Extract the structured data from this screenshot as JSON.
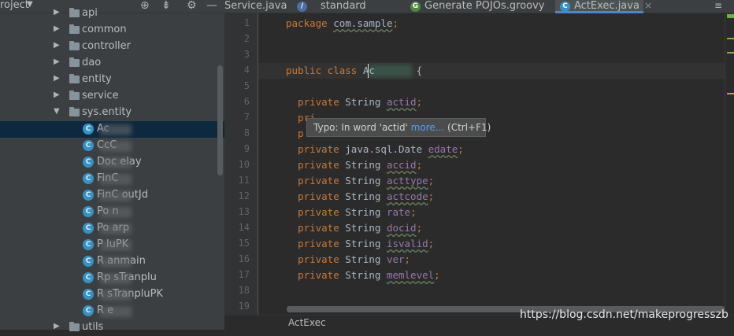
{
  "project_panel": {
    "title": "roject",
    "tree": [
      {
        "label": "api",
        "type": "folder",
        "indent": 1,
        "expanded": false
      },
      {
        "label": "common",
        "type": "folder",
        "indent": 1,
        "expanded": false
      },
      {
        "label": "controller",
        "type": "folder",
        "indent": 1,
        "expanded": false
      },
      {
        "label": "dao",
        "type": "folder",
        "indent": 1,
        "expanded": false
      },
      {
        "label": "entity",
        "type": "folder",
        "indent": 1,
        "expanded": false
      },
      {
        "label": "service",
        "type": "folder",
        "indent": 1,
        "expanded": false
      },
      {
        "label": "sys.entity",
        "type": "folder",
        "indent": 1,
        "expanded": true
      },
      {
        "label": "Ac",
        "type": "class",
        "indent": 2,
        "selected": true
      },
      {
        "label": "CcC",
        "type": "class",
        "indent": 2
      },
      {
        "label": "Doc    elay",
        "type": "class",
        "indent": 2
      },
      {
        "label": "FinC",
        "type": "class",
        "indent": 2
      },
      {
        "label": "FinC    outJd",
        "type": "class",
        "indent": 2
      },
      {
        "label": "Po          n",
        "type": "class",
        "indent": 2
      },
      {
        "label": "Po      arp",
        "type": "class",
        "indent": 2
      },
      {
        "label": "P         luPK",
        "type": "class",
        "indent": 2
      },
      {
        "label": "R        anmain",
        "type": "class",
        "indent": 2
      },
      {
        "label": "Rp     sTranplu",
        "type": "class",
        "indent": 2
      },
      {
        "label": "R      sTranpluPK",
        "type": "class",
        "indent": 2
      },
      {
        "label": "R      e",
        "type": "class",
        "indent": 2
      },
      {
        "label": "utils",
        "type": "folder",
        "indent": 1,
        "expanded": false
      }
    ]
  },
  "tabs": [
    {
      "label": "Service.java",
      "icon": "",
      "active": false
    },
    {
      "label": "standard",
      "icon": "file-icon",
      "active": false
    },
    {
      "label": "Generate POJOs.groovy",
      "icon": "groovy-icon",
      "active": false
    },
    {
      "label": "ActExec.java",
      "icon": "class-icon",
      "active": true
    }
  ],
  "editor": {
    "line_numbers": [
      "1",
      "2",
      "3",
      "4",
      "5",
      "6",
      "7",
      "8",
      "9",
      "10",
      "11",
      "12",
      "13",
      "14",
      "15",
      "16",
      "17",
      "18",
      "19"
    ],
    "lines": [
      [
        {
          "t": "package ",
          "c": "kw"
        },
        {
          "t": "com.sample",
          "c": "pkg"
        },
        {
          "t": ";",
          "c": "kw"
        }
      ],
      [],
      [],
      [
        {
          "t": "public class ",
          "c": "kw"
        },
        {
          "t": "Ac       ",
          "c": "plain"
        },
        {
          "t": "{",
          "c": "plain"
        }
      ],
      [],
      [
        {
          "t": "  private ",
          "c": "kw"
        },
        {
          "t": "String ",
          "c": "plain"
        },
        {
          "t": "actid",
          "c": "fld"
        },
        {
          "t": ";",
          "c": "kw"
        }
      ],
      [
        {
          "t": "  pri",
          "c": "kw"
        }
      ],
      [
        {
          "t": "  p",
          "c": "kw"
        }
      ],
      [
        {
          "t": "  private ",
          "c": "kw"
        },
        {
          "t": "java.sql.Date ",
          "c": "plain"
        },
        {
          "t": "edate",
          "c": "fld"
        },
        {
          "t": ";",
          "c": "kw"
        }
      ],
      [
        {
          "t": "  private ",
          "c": "kw"
        },
        {
          "t": "String ",
          "c": "plain"
        },
        {
          "t": "accid",
          "c": "fld"
        },
        {
          "t": ";",
          "c": "kw"
        }
      ],
      [
        {
          "t": "  private ",
          "c": "kw"
        },
        {
          "t": "String ",
          "c": "plain"
        },
        {
          "t": "acttype",
          "c": "fld"
        },
        {
          "t": ";",
          "c": "kw"
        }
      ],
      [
        {
          "t": "  private ",
          "c": "kw"
        },
        {
          "t": "String ",
          "c": "plain"
        },
        {
          "t": "actcode",
          "c": "fld"
        },
        {
          "t": ";",
          "c": "kw"
        }
      ],
      [
        {
          "t": "  private ",
          "c": "kw"
        },
        {
          "t": "String ",
          "c": "plain"
        },
        {
          "t": "rate",
          "c": "fldp"
        },
        {
          "t": ";",
          "c": "kw"
        }
      ],
      [
        {
          "t": "  private ",
          "c": "kw"
        },
        {
          "t": "String ",
          "c": "plain"
        },
        {
          "t": "docid",
          "c": "fld"
        },
        {
          "t": ";",
          "c": "kw"
        }
      ],
      [
        {
          "t": "  private ",
          "c": "kw"
        },
        {
          "t": "String ",
          "c": "plain"
        },
        {
          "t": "isvalid",
          "c": "fld"
        },
        {
          "t": ";",
          "c": "kw"
        }
      ],
      [
        {
          "t": "  private ",
          "c": "kw"
        },
        {
          "t": "String ",
          "c": "plain"
        },
        {
          "t": "ver",
          "c": "fldp"
        },
        {
          "t": ";",
          "c": "kw"
        }
      ],
      [
        {
          "t": "  private ",
          "c": "kw"
        },
        {
          "t": "String ",
          "c": "plain"
        },
        {
          "t": "memlevel",
          "c": "fld"
        },
        {
          "t": ";",
          "c": "kw"
        }
      ],
      [],
      []
    ]
  },
  "tooltip": {
    "prefix": "Typo: In word 'actid' ",
    "link": "more...",
    "shortcut": " (Ctrl+F1)"
  },
  "breadcrumb": "ActExec",
  "watermark": "https://blog.csdn.net/makeprogresszb",
  "colors": {
    "keyword": "#cc7832",
    "field": "#9876aa",
    "text": "#a9b7c6",
    "selection": "#0d293e",
    "tab_accent": "#4a88c7"
  }
}
